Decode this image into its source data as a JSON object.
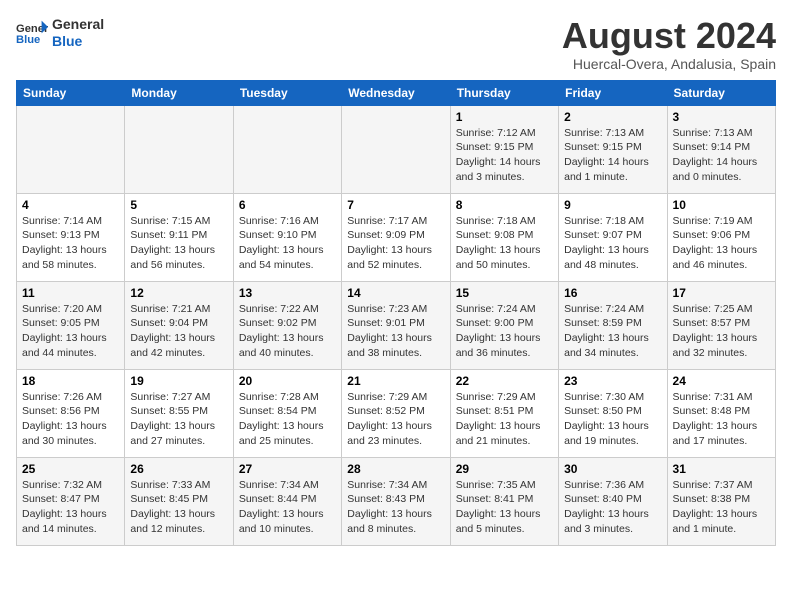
{
  "header": {
    "logo_line1": "General",
    "logo_line2": "Blue",
    "month_year": "August 2024",
    "location": "Huercal-Overa, Andalusia, Spain"
  },
  "weekdays": [
    "Sunday",
    "Monday",
    "Tuesday",
    "Wednesday",
    "Thursday",
    "Friday",
    "Saturday"
  ],
  "weeks": [
    [
      {
        "day": "",
        "info": ""
      },
      {
        "day": "",
        "info": ""
      },
      {
        "day": "",
        "info": ""
      },
      {
        "day": "",
        "info": ""
      },
      {
        "day": "1",
        "info": "Sunrise: 7:12 AM\nSunset: 9:15 PM\nDaylight: 14 hours\nand 3 minutes."
      },
      {
        "day": "2",
        "info": "Sunrise: 7:13 AM\nSunset: 9:15 PM\nDaylight: 14 hours\nand 1 minute."
      },
      {
        "day": "3",
        "info": "Sunrise: 7:13 AM\nSunset: 9:14 PM\nDaylight: 14 hours\nand 0 minutes."
      }
    ],
    [
      {
        "day": "4",
        "info": "Sunrise: 7:14 AM\nSunset: 9:13 PM\nDaylight: 13 hours\nand 58 minutes."
      },
      {
        "day": "5",
        "info": "Sunrise: 7:15 AM\nSunset: 9:11 PM\nDaylight: 13 hours\nand 56 minutes."
      },
      {
        "day": "6",
        "info": "Sunrise: 7:16 AM\nSunset: 9:10 PM\nDaylight: 13 hours\nand 54 minutes."
      },
      {
        "day": "7",
        "info": "Sunrise: 7:17 AM\nSunset: 9:09 PM\nDaylight: 13 hours\nand 52 minutes."
      },
      {
        "day": "8",
        "info": "Sunrise: 7:18 AM\nSunset: 9:08 PM\nDaylight: 13 hours\nand 50 minutes."
      },
      {
        "day": "9",
        "info": "Sunrise: 7:18 AM\nSunset: 9:07 PM\nDaylight: 13 hours\nand 48 minutes."
      },
      {
        "day": "10",
        "info": "Sunrise: 7:19 AM\nSunset: 9:06 PM\nDaylight: 13 hours\nand 46 minutes."
      }
    ],
    [
      {
        "day": "11",
        "info": "Sunrise: 7:20 AM\nSunset: 9:05 PM\nDaylight: 13 hours\nand 44 minutes."
      },
      {
        "day": "12",
        "info": "Sunrise: 7:21 AM\nSunset: 9:04 PM\nDaylight: 13 hours\nand 42 minutes."
      },
      {
        "day": "13",
        "info": "Sunrise: 7:22 AM\nSunset: 9:02 PM\nDaylight: 13 hours\nand 40 minutes."
      },
      {
        "day": "14",
        "info": "Sunrise: 7:23 AM\nSunset: 9:01 PM\nDaylight: 13 hours\nand 38 minutes."
      },
      {
        "day": "15",
        "info": "Sunrise: 7:24 AM\nSunset: 9:00 PM\nDaylight: 13 hours\nand 36 minutes."
      },
      {
        "day": "16",
        "info": "Sunrise: 7:24 AM\nSunset: 8:59 PM\nDaylight: 13 hours\nand 34 minutes."
      },
      {
        "day": "17",
        "info": "Sunrise: 7:25 AM\nSunset: 8:57 PM\nDaylight: 13 hours\nand 32 minutes."
      }
    ],
    [
      {
        "day": "18",
        "info": "Sunrise: 7:26 AM\nSunset: 8:56 PM\nDaylight: 13 hours\nand 30 minutes."
      },
      {
        "day": "19",
        "info": "Sunrise: 7:27 AM\nSunset: 8:55 PM\nDaylight: 13 hours\nand 27 minutes."
      },
      {
        "day": "20",
        "info": "Sunrise: 7:28 AM\nSunset: 8:54 PM\nDaylight: 13 hours\nand 25 minutes."
      },
      {
        "day": "21",
        "info": "Sunrise: 7:29 AM\nSunset: 8:52 PM\nDaylight: 13 hours\nand 23 minutes."
      },
      {
        "day": "22",
        "info": "Sunrise: 7:29 AM\nSunset: 8:51 PM\nDaylight: 13 hours\nand 21 minutes."
      },
      {
        "day": "23",
        "info": "Sunrise: 7:30 AM\nSunset: 8:50 PM\nDaylight: 13 hours\nand 19 minutes."
      },
      {
        "day": "24",
        "info": "Sunrise: 7:31 AM\nSunset: 8:48 PM\nDaylight: 13 hours\nand 17 minutes."
      }
    ],
    [
      {
        "day": "25",
        "info": "Sunrise: 7:32 AM\nSunset: 8:47 PM\nDaylight: 13 hours\nand 14 minutes."
      },
      {
        "day": "26",
        "info": "Sunrise: 7:33 AM\nSunset: 8:45 PM\nDaylight: 13 hours\nand 12 minutes."
      },
      {
        "day": "27",
        "info": "Sunrise: 7:34 AM\nSunset: 8:44 PM\nDaylight: 13 hours\nand 10 minutes."
      },
      {
        "day": "28",
        "info": "Sunrise: 7:34 AM\nSunset: 8:43 PM\nDaylight: 13 hours\nand 8 minutes."
      },
      {
        "day": "29",
        "info": "Sunrise: 7:35 AM\nSunset: 8:41 PM\nDaylight: 13 hours\nand 5 minutes."
      },
      {
        "day": "30",
        "info": "Sunrise: 7:36 AM\nSunset: 8:40 PM\nDaylight: 13 hours\nand 3 minutes."
      },
      {
        "day": "31",
        "info": "Sunrise: 7:37 AM\nSunset: 8:38 PM\nDaylight: 13 hours\nand 1 minute."
      }
    ]
  ]
}
